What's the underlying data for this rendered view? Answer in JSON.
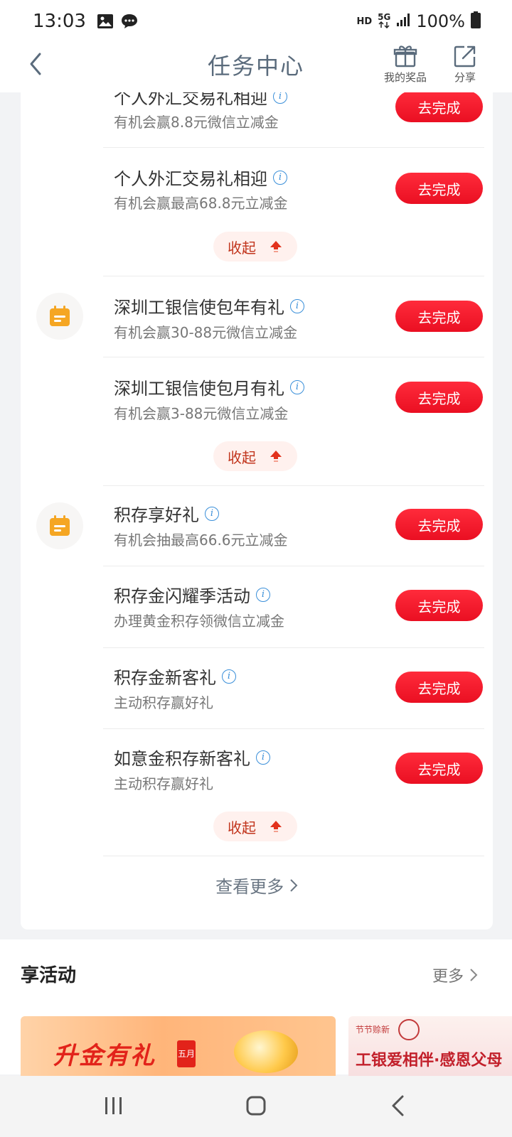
{
  "status_bar": {
    "time": "13:03",
    "hd": "HD",
    "network": "5G",
    "battery": "100%"
  },
  "header": {
    "title": "任务中心",
    "prize_label": "我的奖品",
    "share_label": "分享"
  },
  "tasks": {
    "row0": {
      "title": "个人外汇交易礼相迎",
      "sub": "有机会赢8.8元微信立减金",
      "button": "去完成"
    },
    "row1": {
      "title": "个人外汇交易礼相迎",
      "sub": "有机会赢最高68.8元立减金",
      "button": "去完成"
    },
    "collapse1": "收起",
    "row2": {
      "title": "深圳工银信使包年有礼",
      "sub": "有机会赢30-88元微信立减金",
      "button": "去完成"
    },
    "row3": {
      "title": "深圳工银信使包月有礼",
      "sub": "有机会赢3-88元微信立减金",
      "button": "去完成"
    },
    "collapse2": "收起",
    "row4": {
      "title": "积存享好礼",
      "sub": "有机会抽最高66.6元立减金",
      "button": "去完成"
    },
    "row5": {
      "title": "积存金闪耀季活动",
      "sub": "办理黄金积存领微信立减金",
      "button": "去完成"
    },
    "row6": {
      "title": "积存金新客礼",
      "sub": "主动积存赢好礼",
      "button": "去完成"
    },
    "row7": {
      "title": "如意金积存新客礼",
      "sub": "主动积存赢好礼",
      "button": "去完成"
    },
    "collapse3": "收起",
    "view_more": "查看更多"
  },
  "activity": {
    "title": "享活动",
    "more": "更多",
    "banner1": {
      "title": "升金有礼",
      "tag": "五月"
    },
    "banner2": {
      "tag": "节节赊新",
      "title": "工银爱相伴·感恩父母"
    }
  },
  "colors": {
    "button_red": "#ea0f22",
    "collapse_bg": "#fff1ee",
    "collapse_text": "#c1341c",
    "info_blue": "#3a8fd9",
    "calendar_orange": "#f5a623"
  },
  "icons": {
    "back": "chevron-left-icon",
    "prize": "gift-icon",
    "share": "share-icon",
    "group": "calendar-icon",
    "collapse": "arrow-up-icon"
  }
}
